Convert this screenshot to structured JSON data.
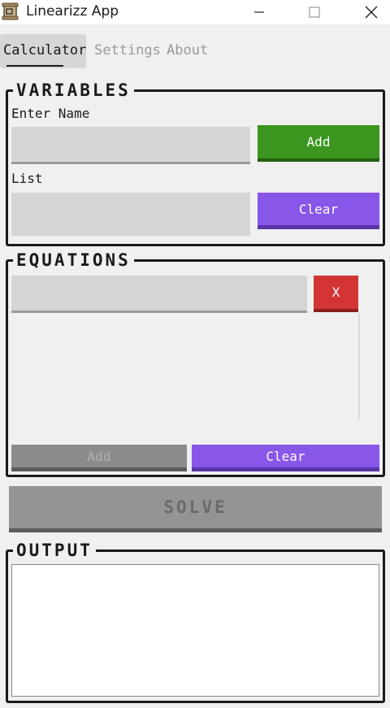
{
  "window": {
    "title": "Linearizz App",
    "icon": "scroll-app-icon",
    "controls": [
      "minimize-icon",
      "maximize-icon",
      "close-icon"
    ]
  },
  "tabs": [
    {
      "label": "Calculator",
      "active": true
    },
    {
      "label": "Settings",
      "active": false
    },
    {
      "label": "About",
      "active": false
    }
  ],
  "variables": {
    "title": "VARIABLES",
    "name_label": "Enter Name",
    "name_value": "",
    "add_label": "Add",
    "list_label": "List",
    "list_value": "",
    "clear_label": "Clear"
  },
  "equations": {
    "title": "EQUATIONS",
    "entry_value": "",
    "remove_label": "X",
    "add_label": "Add",
    "add_enabled": false,
    "clear_label": "Clear"
  },
  "solve": {
    "label": "SOLVE",
    "enabled": false
  },
  "output": {
    "title": "OUTPUT",
    "value": ""
  },
  "colors": {
    "background": "#f0f0f0",
    "add_green": "#3a961e",
    "clear_purple": "#8856e8",
    "remove_red": "#d33535",
    "disabled_gray": "#8c8c8c",
    "field_gray": "#d5d5d5"
  }
}
